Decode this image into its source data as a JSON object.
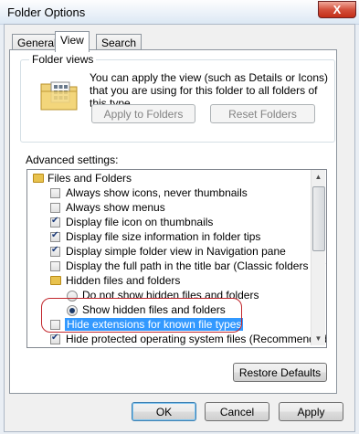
{
  "window": {
    "title": "Folder Options",
    "close_label": "X"
  },
  "tabs": [
    {
      "label": "General",
      "active": false
    },
    {
      "label": "View",
      "active": true
    },
    {
      "label": "Search",
      "active": false
    }
  ],
  "folder_views": {
    "group_label": "Folder views",
    "description": "You can apply the view (such as Details or Icons) that you are using for this folder to all folders of this type.",
    "apply_button": "Apply to Folders",
    "reset_button": "Reset Folders"
  },
  "advanced": {
    "label": "Advanced settings:",
    "items": [
      {
        "type": "folder",
        "label": "Files and Folders",
        "checked": null
      },
      {
        "type": "checkbox",
        "label": "Always show icons, never thumbnails",
        "checked": false
      },
      {
        "type": "checkbox",
        "label": "Always show menus",
        "checked": false
      },
      {
        "type": "checkbox",
        "label": "Display file icon on thumbnails",
        "checked": true
      },
      {
        "type": "checkbox",
        "label": "Display file size information in folder tips",
        "checked": true
      },
      {
        "type": "checkbox",
        "label": "Display simple folder view in Navigation pane",
        "checked": true
      },
      {
        "type": "checkbox",
        "label": "Display the full path in the title bar (Classic folders only)",
        "checked": false
      },
      {
        "type": "folder",
        "label": "Hidden files and folders",
        "checked": null
      },
      {
        "type": "radio",
        "label": "Do not show hidden files and folders",
        "checked": false
      },
      {
        "type": "radio",
        "label": "Show hidden files and folders",
        "checked": true
      },
      {
        "type": "checkbox",
        "label": "Hide extensions for known file types",
        "checked": false,
        "selected": true
      },
      {
        "type": "checkbox",
        "label": "Hide protected operating system files (Recommended)",
        "checked": true
      }
    ]
  },
  "restore_defaults_button": "Restore Defaults",
  "footer": {
    "ok": "OK",
    "cancel": "Cancel",
    "apply": "Apply"
  },
  "colors": {
    "highlight_oval": "#c2272d",
    "selection": "#3399ff"
  }
}
